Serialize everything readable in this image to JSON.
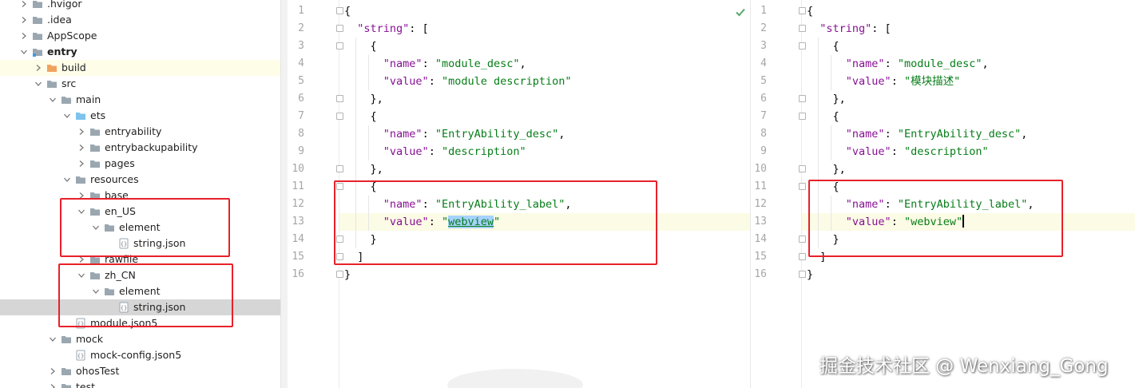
{
  "project_tree": [
    {
      "name": ".hvigor",
      "depth": 0,
      "kind": "folder",
      "expanded": false
    },
    {
      "name": ".idea",
      "depth": 0,
      "kind": "folder",
      "expanded": false
    },
    {
      "name": "AppScope",
      "depth": 0,
      "kind": "folder",
      "expanded": false
    },
    {
      "name": "entry",
      "depth": 0,
      "kind": "module",
      "expanded": true,
      "bold": true
    },
    {
      "name": "build",
      "depth": 1,
      "kind": "folder-orange",
      "expanded": false,
      "highlight": true
    },
    {
      "name": "src",
      "depth": 1,
      "kind": "folder",
      "expanded": true
    },
    {
      "name": "main",
      "depth": 2,
      "kind": "folder",
      "expanded": true
    },
    {
      "name": "ets",
      "depth": 3,
      "kind": "folder-blue",
      "expanded": true
    },
    {
      "name": "entryability",
      "depth": 4,
      "kind": "folder",
      "expanded": false
    },
    {
      "name": "entrybackupability",
      "depth": 4,
      "kind": "folder",
      "expanded": false
    },
    {
      "name": "pages",
      "depth": 4,
      "kind": "folder",
      "expanded": false
    },
    {
      "name": "resources",
      "depth": 3,
      "kind": "folder",
      "expanded": true
    },
    {
      "name": "base",
      "depth": 4,
      "kind": "folder",
      "expanded": false
    },
    {
      "name": "en_US",
      "depth": 4,
      "kind": "folder",
      "expanded": true
    },
    {
      "name": "element",
      "depth": 5,
      "kind": "folder",
      "expanded": true
    },
    {
      "name": "string.json",
      "depth": 6,
      "kind": "json"
    },
    {
      "name": "rawfile",
      "depth": 4,
      "kind": "folder",
      "expanded": false
    },
    {
      "name": "zh_CN",
      "depth": 4,
      "kind": "folder",
      "expanded": true
    },
    {
      "name": "element",
      "depth": 5,
      "kind": "folder",
      "expanded": true
    },
    {
      "name": "string.json",
      "depth": 6,
      "kind": "json",
      "selected": true
    },
    {
      "name": "module.json5",
      "depth": 3,
      "kind": "json"
    },
    {
      "name": "mock",
      "depth": 2,
      "kind": "folder",
      "expanded": true
    },
    {
      "name": "mock-config.json5",
      "depth": 3,
      "kind": "json"
    },
    {
      "name": "ohosTest",
      "depth": 2,
      "kind": "folder",
      "expanded": false
    },
    {
      "name": "test",
      "depth": 2,
      "kind": "folder",
      "expanded": false
    }
  ],
  "editors": [
    {
      "id": "left",
      "caret_line": 13,
      "lines": [
        [
          [
            "p",
            "{"
          ]
        ],
        [
          [
            "p",
            "  "
          ],
          [
            "k",
            "\"string\""
          ],
          [
            "p",
            ": ["
          ]
        ],
        [
          [
            "p",
            "    {"
          ]
        ],
        [
          [
            "p",
            "      "
          ],
          [
            "k",
            "\"name\""
          ],
          [
            "p",
            ": "
          ],
          [
            "s",
            "\"module_desc\""
          ],
          [
            "p",
            ","
          ]
        ],
        [
          [
            "p",
            "      "
          ],
          [
            "k",
            "\"value\""
          ],
          [
            "p",
            ": "
          ],
          [
            "s",
            "\"module description\""
          ]
        ],
        [
          [
            "p",
            "    },"
          ]
        ],
        [
          [
            "p",
            "    {"
          ]
        ],
        [
          [
            "p",
            "      "
          ],
          [
            "k",
            "\"name\""
          ],
          [
            "p",
            ": "
          ],
          [
            "s",
            "\"EntryAbility_desc\""
          ],
          [
            "p",
            ","
          ]
        ],
        [
          [
            "p",
            "      "
          ],
          [
            "k",
            "\"value\""
          ],
          [
            "p",
            ": "
          ],
          [
            "s",
            "\"description\""
          ]
        ],
        [
          [
            "p",
            "    },"
          ]
        ],
        [
          [
            "p",
            "    {"
          ]
        ],
        [
          [
            "p",
            "      "
          ],
          [
            "k",
            "\"name\""
          ],
          [
            "p",
            ": "
          ],
          [
            "s",
            "\"EntryAbility_label\""
          ],
          [
            "p",
            ","
          ]
        ],
        [
          [
            "p",
            "      "
          ],
          [
            "k",
            "\"value\""
          ],
          [
            "p",
            ": "
          ],
          [
            "s",
            "\""
          ],
          [
            "mark",
            "webview"
          ],
          [
            "s",
            "\""
          ]
        ],
        [
          [
            "p",
            "    }"
          ]
        ],
        [
          [
            "p",
            "  ]"
          ]
        ],
        [
          [
            "p",
            "}"
          ]
        ]
      ]
    },
    {
      "id": "right",
      "caret_line": 13,
      "lines": [
        [
          [
            "p",
            "{"
          ]
        ],
        [
          [
            "p",
            "  "
          ],
          [
            "k",
            "\"string\""
          ],
          [
            "p",
            ": ["
          ]
        ],
        [
          [
            "p",
            "    {"
          ]
        ],
        [
          [
            "p",
            "      "
          ],
          [
            "k",
            "\"name\""
          ],
          [
            "p",
            ": "
          ],
          [
            "s",
            "\"module_desc\""
          ],
          [
            "p",
            ","
          ]
        ],
        [
          [
            "p",
            "      "
          ],
          [
            "k",
            "\"value\""
          ],
          [
            "p",
            ": "
          ],
          [
            "s",
            "\"模块描述\""
          ]
        ],
        [
          [
            "p",
            "    },"
          ]
        ],
        [
          [
            "p",
            "    {"
          ]
        ],
        [
          [
            "p",
            "      "
          ],
          [
            "k",
            "\"name\""
          ],
          [
            "p",
            ": "
          ],
          [
            "s",
            "\"EntryAbility_desc\""
          ],
          [
            "p",
            ","
          ]
        ],
        [
          [
            "p",
            "      "
          ],
          [
            "k",
            "\"value\""
          ],
          [
            "p",
            ": "
          ],
          [
            "s",
            "\"description\""
          ]
        ],
        [
          [
            "p",
            "    },"
          ]
        ],
        [
          [
            "p",
            "    {"
          ]
        ],
        [
          [
            "p",
            "      "
          ],
          [
            "k",
            "\"name\""
          ],
          [
            "p",
            ": "
          ],
          [
            "s",
            "\"EntryAbility_label\""
          ],
          [
            "p",
            ","
          ]
        ],
        [
          [
            "p",
            "      "
          ],
          [
            "k",
            "\"value\""
          ],
          [
            "p",
            ": "
          ],
          [
            "s",
            "\"webview\""
          ],
          [
            "caret",
            ""
          ]
        ],
        [
          [
            "p",
            "    }"
          ]
        ],
        [
          [
            "p",
            "  ]"
          ]
        ],
        [
          [
            "p",
            "}"
          ]
        ]
      ]
    }
  ],
  "fold_lines": [
    1,
    2,
    3,
    6,
    7,
    10,
    11,
    14,
    15,
    16
  ],
  "watermark": "掘金技术社区 @ Wenxiang_Gong",
  "colors": {
    "key": "#871094",
    "string": "#067d17",
    "annotation": "#e8212a",
    "selection": "#a6d2ff",
    "folder": "#9aa7b0"
  }
}
